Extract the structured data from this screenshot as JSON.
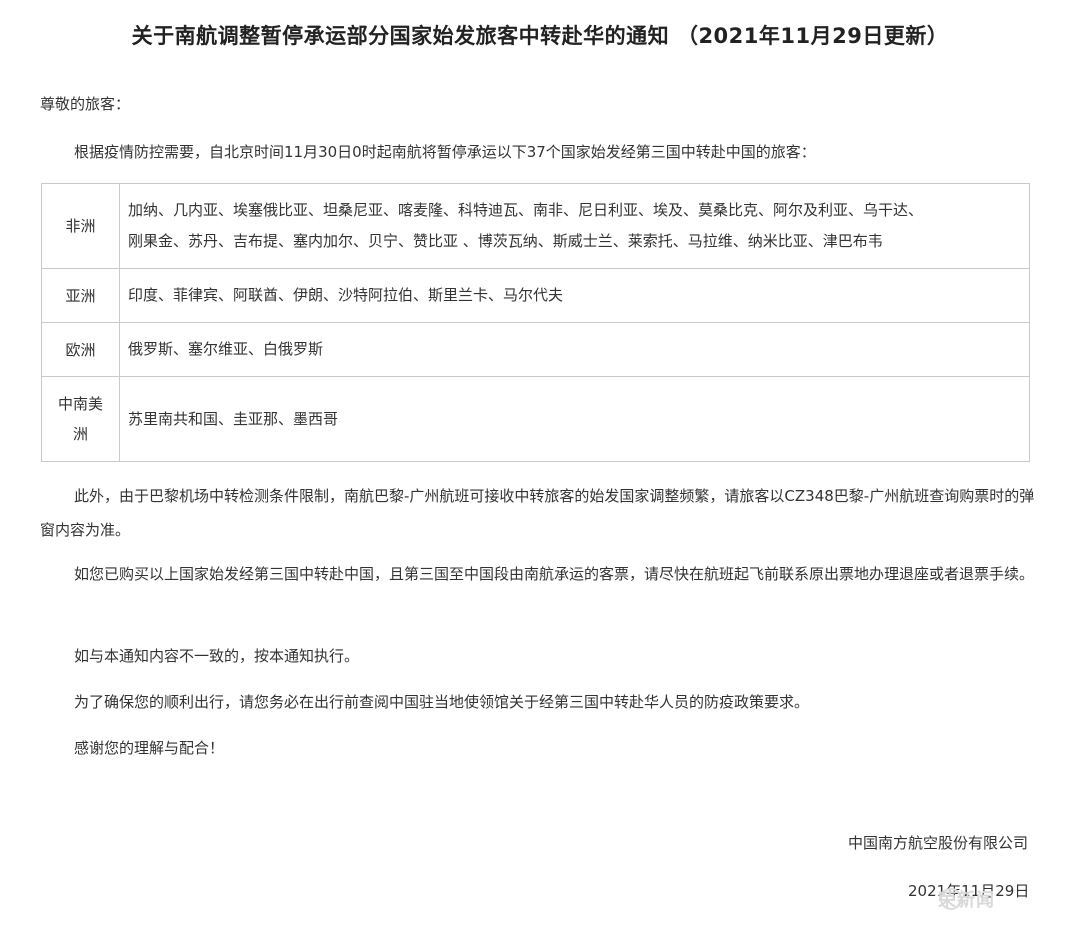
{
  "title": "关于南航调整暂停承运部分国家始发旅客中转赴华的通知  （2021年11月29日更新）",
  "greeting": "尊敬的旅客：",
  "intro": "根据疫情防控需要，自北京时间11月30日0时起南航将暂停承运以下37个国家始发经第三国中转赴中国的旅客：",
  "table": {
    "rows": [
      {
        "region": "非洲",
        "countries_line1": "加纳、几内亚、埃塞俄比亚、坦桑尼亚、喀麦隆、科特迪瓦、南非、尼日利亚、埃及、莫桑比克、阿尔及利亚、乌干达、",
        "countries_line2": "刚果金、苏丹、吉布提、塞内加尔、贝宁、赞比亚 、博茨瓦纳、斯威士兰、莱索托、马拉维、纳米比亚、津巴布韦"
      },
      {
        "region": "亚洲",
        "countries_line1": "印度、菲律宾、阿联酋、伊朗、沙特阿拉伯、斯里兰卡、马尔代夫"
      },
      {
        "region": "欧洲",
        "countries_line1": "俄罗斯、塞尔维亚、白俄罗斯"
      },
      {
        "region_line1": "中南美",
        "region_line2": "洲",
        "countries_line1": "苏里南共和国、圭亚那、墨西哥"
      }
    ]
  },
  "paragraphs": [
    "此外，由于巴黎机场中转检测条件限制，南航巴黎-广州航班可接收中转旅客的始发国家调整频繁，请旅客以CZ348巴黎-广州航班查询购票时的弹窗内容为准。",
    "如您已购买以上国家始发经第三国中转赴中国，且第三国至中国段由南航承运的客票，请尽快在航班起飞前联系原出票地办理退座或者退票手续。",
    "如与本通知内容不一致的，按本通知执行。",
    "为了确保您的顺利出行，请您务必在出行前查阅中国驻当地使领馆关于经第三国中转赴华人员的防疫政策要求。",
    "感谢您的理解与配合！"
  ],
  "signature": {
    "company": "中国南方航空股份有限公司",
    "date": "2021年11月29日"
  },
  "watermark": {
    "text": "荣新闻",
    "icon": "news-logo-icon"
  }
}
